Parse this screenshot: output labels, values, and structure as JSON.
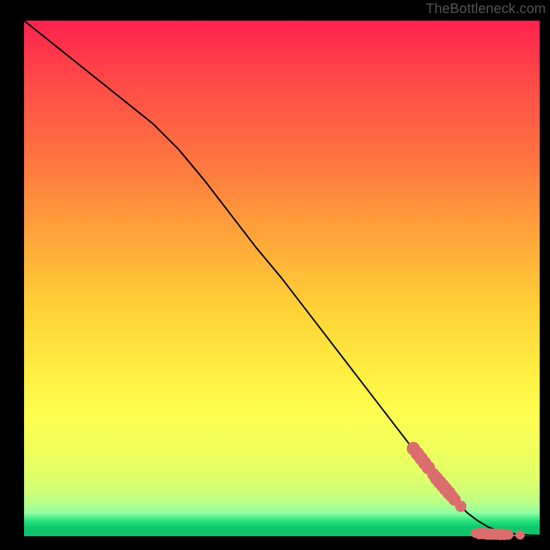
{
  "watermark_text": "TheBottleneck.com",
  "colors": {
    "frame_border": "#000000",
    "line": "#000000",
    "marker": "#db6d6d",
    "gradient_top": "#ff224e",
    "gradient_mid": "#fff244",
    "gradient_bottom": "#11bf6a"
  },
  "chart_data": {
    "type": "line",
    "title": "",
    "xlabel": "",
    "ylabel": "",
    "xlim": [
      0,
      100
    ],
    "ylim": [
      0,
      100
    ],
    "x": [
      0,
      5,
      10,
      15,
      20,
      25,
      28,
      30,
      35,
      40,
      45,
      50,
      55,
      60,
      65,
      70,
      75,
      80,
      82,
      84,
      86,
      88,
      90,
      92,
      94,
      96,
      98,
      100
    ],
    "values": [
      100,
      96,
      92,
      88,
      84,
      80,
      77,
      75,
      69,
      62.5,
      56,
      50,
      43.5,
      37,
      30.5,
      24,
      17.5,
      11,
      8.8,
      6.6,
      4.5,
      3.0,
      1.8,
      1.0,
      0.6,
      0.35,
      0.2,
      0.15
    ],
    "markers": [
      {
        "x": 75.5,
        "y": 17.0,
        "r": 1.3
      },
      {
        "x": 76.3,
        "y": 16.0,
        "r": 1.3
      },
      {
        "x": 77.0,
        "y": 15.1,
        "r": 1.3
      },
      {
        "x": 77.7,
        "y": 14.2,
        "r": 1.3
      },
      {
        "x": 78.4,
        "y": 13.3,
        "r": 1.3
      },
      {
        "x": 79.4,
        "y": 12.0,
        "r": 1.2
      },
      {
        "x": 80.0,
        "y": 11.2,
        "r": 1.3
      },
      {
        "x": 80.6,
        "y": 10.5,
        "r": 1.3
      },
      {
        "x": 81.2,
        "y": 9.8,
        "r": 1.3
      },
      {
        "x": 81.8,
        "y": 9.1,
        "r": 1.3
      },
      {
        "x": 82.4,
        "y": 8.4,
        "r": 1.3
      },
      {
        "x": 83.0,
        "y": 7.7,
        "r": 1.2
      },
      {
        "x": 83.5,
        "y": 7.1,
        "r": 1.2
      },
      {
        "x": 84.7,
        "y": 5.8,
        "r": 1.1
      },
      {
        "x": 87.5,
        "y": 0.6,
        "r": 0.9
      },
      {
        "x": 88.3,
        "y": 0.5,
        "r": 1.1
      },
      {
        "x": 89.1,
        "y": 0.5,
        "r": 1.1
      },
      {
        "x": 89.9,
        "y": 0.4,
        "r": 1.1
      },
      {
        "x": 90.7,
        "y": 0.4,
        "r": 1.1
      },
      {
        "x": 91.5,
        "y": 0.4,
        "r": 1.1
      },
      {
        "x": 92.3,
        "y": 0.35,
        "r": 1.1
      },
      {
        "x": 93.1,
        "y": 0.35,
        "r": 1.1
      },
      {
        "x": 93.9,
        "y": 0.3,
        "r": 1.0
      },
      {
        "x": 96.2,
        "y": 0.25,
        "r": 0.9
      }
    ]
  }
}
